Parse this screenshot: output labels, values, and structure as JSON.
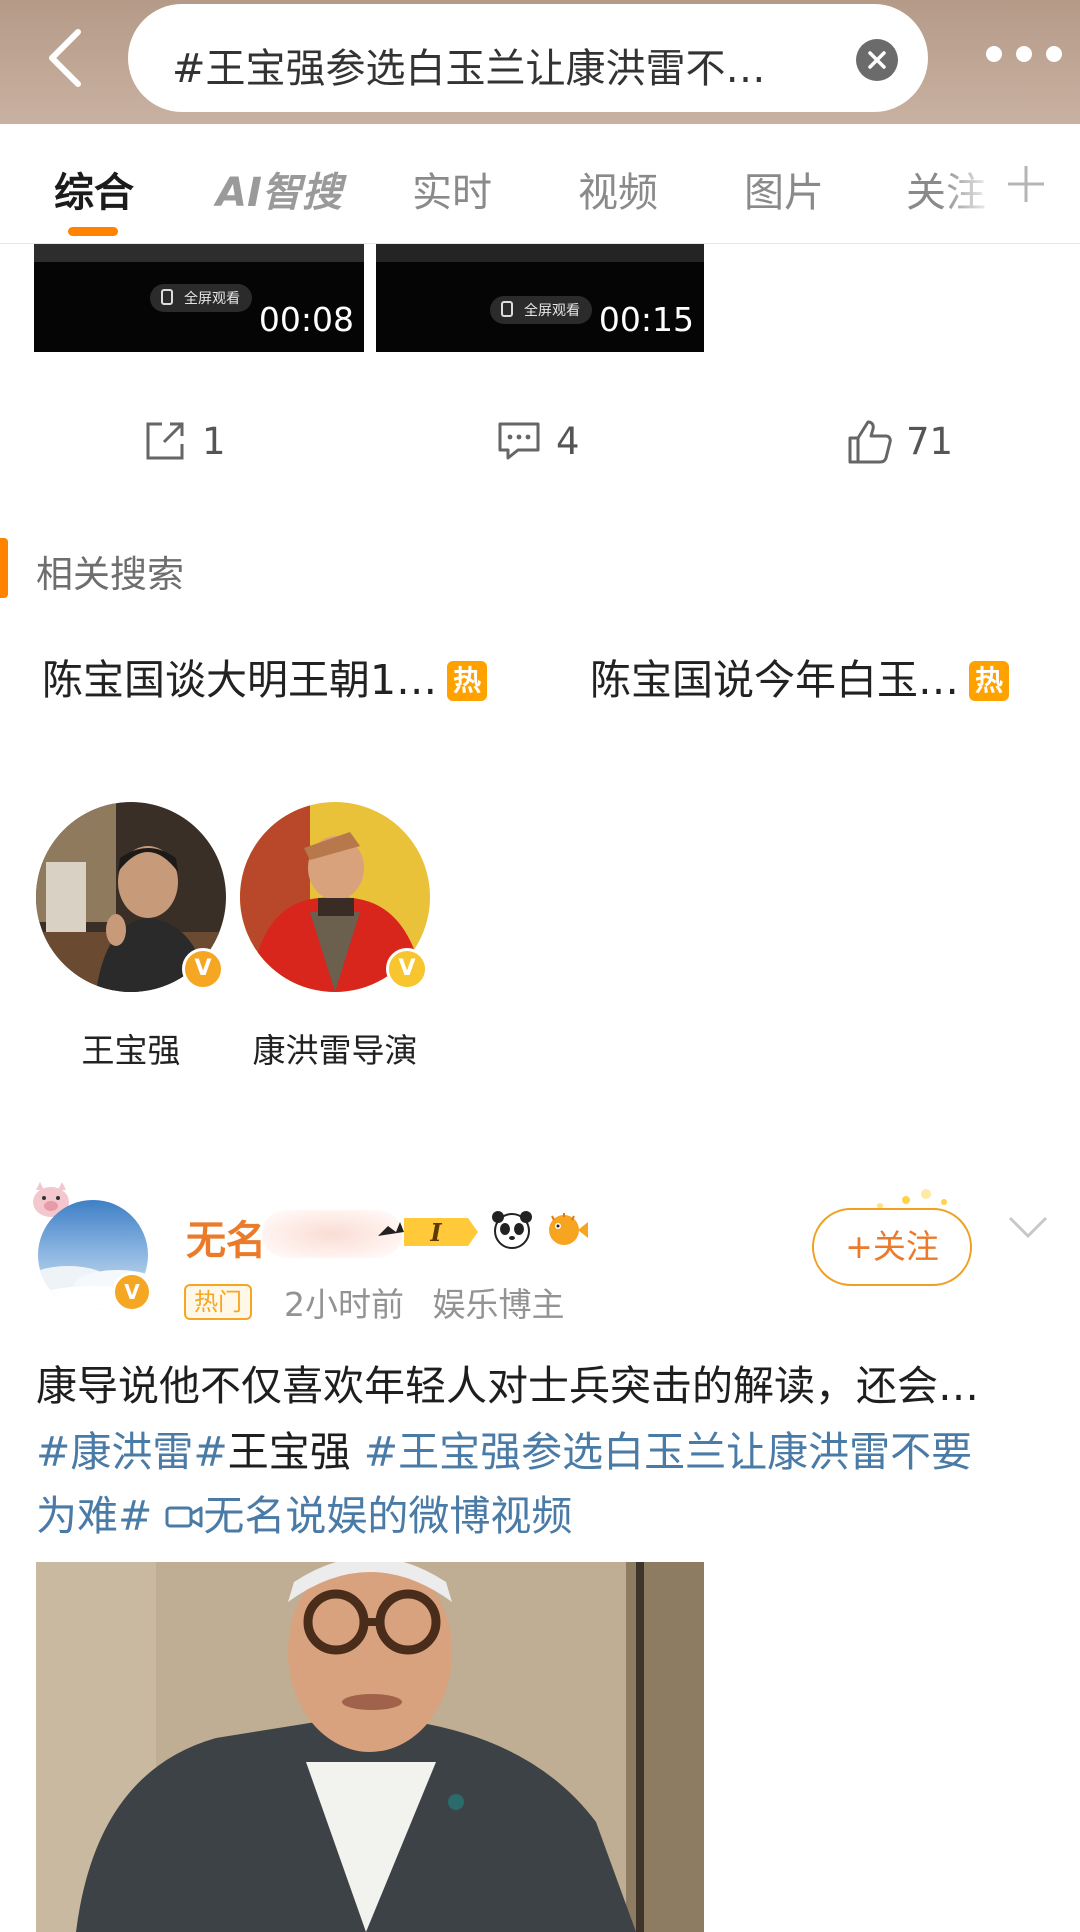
{
  "search": {
    "query": "#王宝强参选白玉兰让康洪雷不…"
  },
  "tabs": [
    {
      "label": "综合"
    },
    {
      "label": "AI智搜"
    },
    {
      "label": "实时"
    },
    {
      "label": "视频"
    },
    {
      "label": "图片"
    },
    {
      "label": "关注"
    }
  ],
  "videos": [
    {
      "fullscreen_label": "全屏观看",
      "duration": "00:08"
    },
    {
      "fullscreen_label": "全屏观看",
      "duration": "00:15"
    }
  ],
  "actions": {
    "share_count": "1",
    "comment_count": "4",
    "like_count": "71"
  },
  "related": {
    "title": "相关搜索",
    "items": [
      {
        "text": "陈宝国谈大明王朝1…",
        "badge": "热"
      },
      {
        "text": "陈宝国说今年白玉…",
        "badge": "热"
      }
    ]
  },
  "accounts": [
    {
      "name": "王宝强",
      "verify": "V",
      "verify_color": "#f5a623"
    },
    {
      "name": "康洪雷导演",
      "verify": "V",
      "verify_color": "#f7c52e"
    }
  ],
  "post": {
    "author_visible": "无名",
    "level_badge": "I",
    "hot_tag": "热门",
    "time": "2小时前",
    "role": "娱乐博主",
    "follow_label": "+关注",
    "line1": "康导说他不仅喜欢年轻人对士兵突击的解读，还会…",
    "topic1": "#康洪雷#",
    "plain": "王宝强",
    "topic2": "#王宝强参选白玉兰让康洪雷不要",
    "topic2_cont": "为难#",
    "video_link": "无名说娱的微博视频"
  },
  "colors": {
    "accent": "#ff8200",
    "topic": "#4a7ba6",
    "hot_badge": "#ffa200"
  }
}
